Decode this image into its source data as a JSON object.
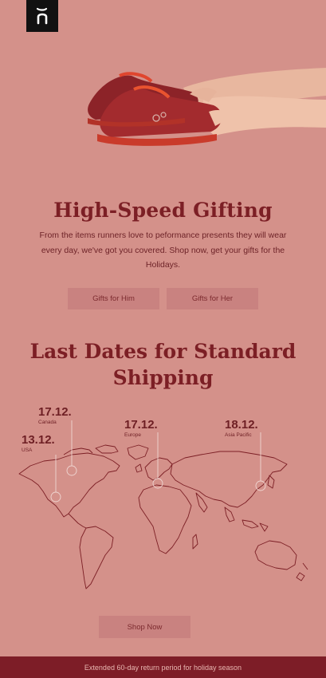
{
  "brand": {
    "logo_icon": "on-logo-icon"
  },
  "hero": {
    "image_icon": "running-shoes-held-in-hands"
  },
  "intro": {
    "headline": "High-Speed Gifting",
    "body": "From the items runners love to peformance presents they will wear every day, we've got you covered. Shop now, get your gifts for the Holidays."
  },
  "buttons": {
    "gifts_him": "Gifts for Him",
    "gifts_her": "Gifts for Her",
    "shop_now": "Shop Now"
  },
  "shipping": {
    "title": "Last Dates for Standard Shipping",
    "regions": [
      {
        "date": "17.12.",
        "region": "Canada"
      },
      {
        "date": "13.12.",
        "region": "USA"
      },
      {
        "date": "17.12.",
        "region": "Europe"
      },
      {
        "date": "18.12.",
        "region": "Asia Pacific"
      }
    ]
  },
  "footer": {
    "text": "Extended 60-day return period for holiday season"
  },
  "colors": {
    "background": "#d4918a",
    "accent": "#7c1f25",
    "button": "#c98280",
    "footer_bg": "#7d1d27"
  }
}
